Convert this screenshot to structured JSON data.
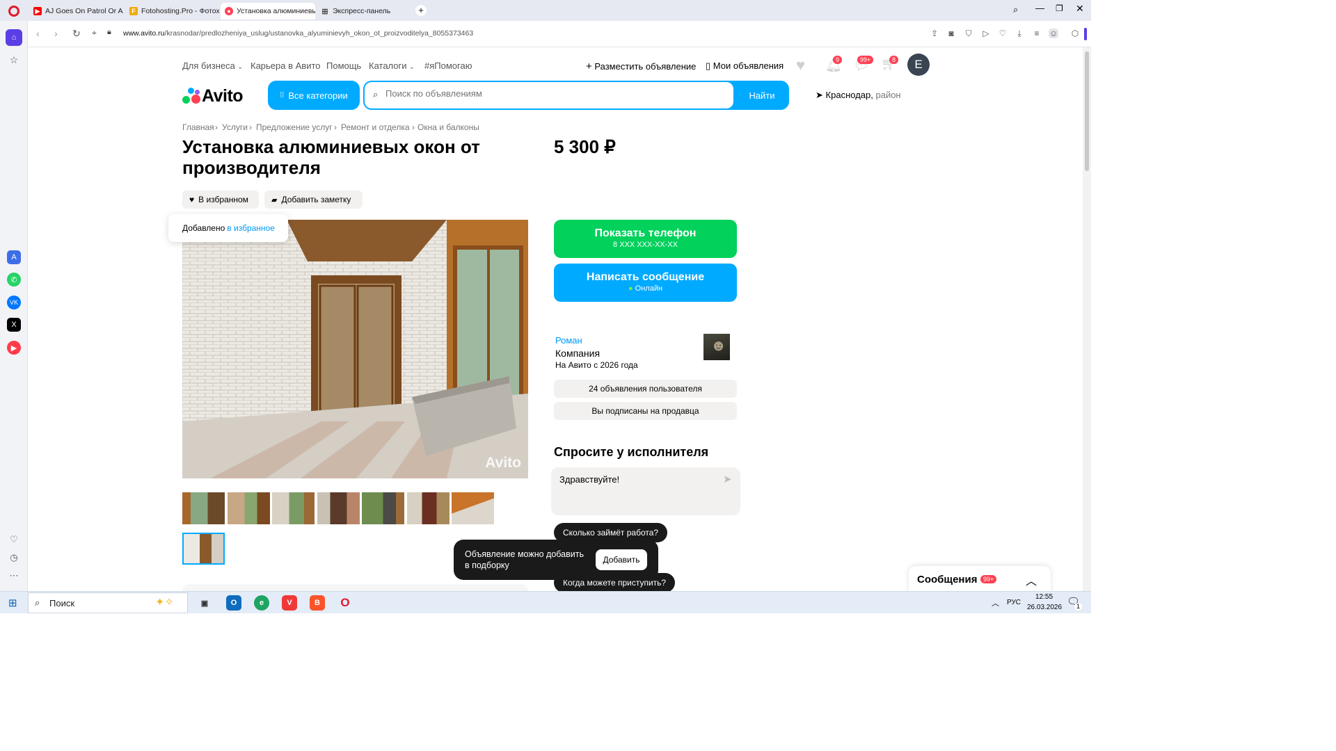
{
  "browser": {
    "tabs": [
      {
        "label": "AJ Goes On Patrol Or AJ S",
        "favicon": "youtube-icon",
        "active": false
      },
      {
        "label": "Fotohosting.Pro - Фотохо",
        "favicon": "fotohosting-icon",
        "active": false
      },
      {
        "label": "Установка алюминиевых",
        "favicon": "avito-icon",
        "active": true
      },
      {
        "label": "Экспресс-панель",
        "favicon": "grid-icon",
        "active": false
      }
    ],
    "url_host": "www.avito.ru",
    "url_path": "/krasnodar/predlozheniya_uslug/ustanovka_alyuminievyh_okon_ot_proizvoditelya_8055373463"
  },
  "site": {
    "top_links": [
      "Для бизнеса",
      "Карьера в Авито",
      "Помощь",
      "Каталоги",
      "#яПомогаю"
    ],
    "post_ad": "Разместить объявление",
    "my_ads": "Мои объявления",
    "badges": {
      "notifications": "9",
      "messages": "99+",
      "cart": "8"
    },
    "avatar_letter": "E",
    "logo": "Avito",
    "all_categories": "Все категории",
    "search_placeholder": "Поиск по объявлениям",
    "search_button": "Найти",
    "location_city": "Краснодар,",
    "location_area": "район"
  },
  "breadcrumbs": [
    "Главная",
    "Услуги",
    "Предложение услуг",
    "Ремонт и отделка",
    "Окна и балконы"
  ],
  "listing": {
    "title": "Установка алюминиевых окон от производителя",
    "price": "5 300 ₽",
    "favorite_chip": "В избранном",
    "note_chip": "Добавить заметку",
    "toast_prefix": "Добавлено",
    "toast_link": "в избранное",
    "photo_watermark": "Avito",
    "thumbnail_count": 8
  },
  "contact": {
    "phone_button": "Показать телефон",
    "phone_mask": "8 XXX XXX-XX-XX",
    "message_button": "Написать сообщение",
    "online": "Онлайн"
  },
  "seller": {
    "name": "Роман",
    "type": "Компания",
    "since": "На Авито с 2026 года",
    "ads_count": "24 объявления пользователя",
    "subscribed": "Вы подписаны на продавца"
  },
  "ask": {
    "heading": "Спросите у исполнителя",
    "input_value": "Здравствуйте!",
    "suggestions": [
      "Сколько займёт работа?",
      "Когда можете приступить?"
    ]
  },
  "collection_toast": {
    "text": "Объявление можно добавить в подборку",
    "button": "Добавить"
  },
  "messages_panel": {
    "label": "Сообщения",
    "badge": "99+"
  },
  "taskbar": {
    "search": "Поиск",
    "lang": "РУС",
    "time": "12:55",
    "date": "26.03.2026",
    "notif_count": "1"
  },
  "colors": {
    "avito_blue": "#00aaff",
    "avito_green": "#02d15c",
    "badge_red": "#ff4053"
  }
}
